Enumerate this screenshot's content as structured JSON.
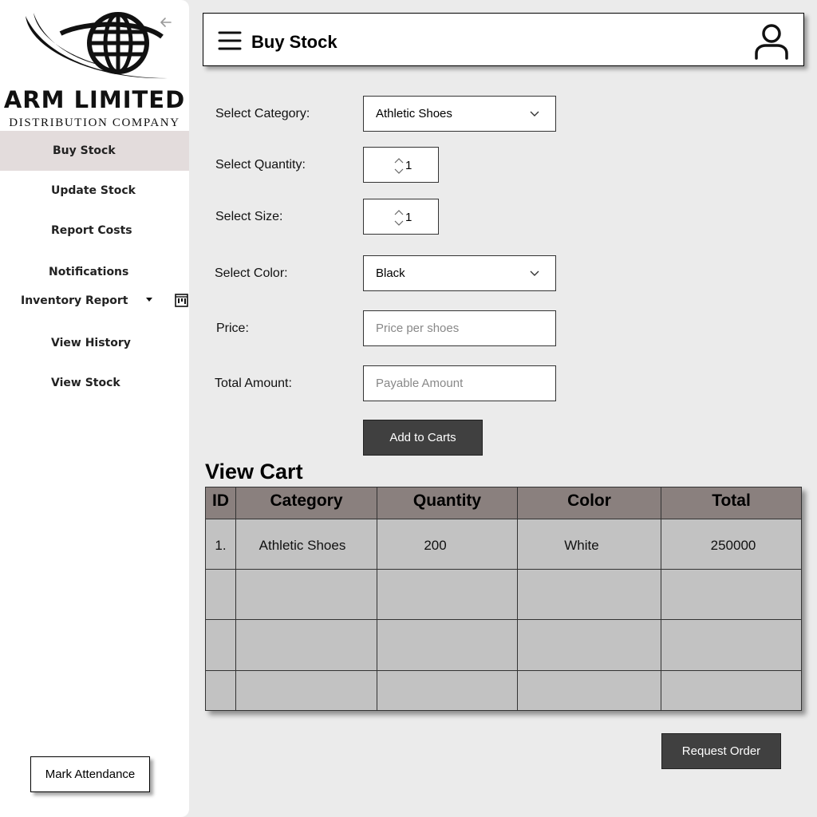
{
  "brand": {
    "name": "ARM LIMITED",
    "tagline": "DISTRIBUTION COMPANY"
  },
  "sidebar": {
    "items": [
      {
        "label": "Buy Stock",
        "active": true
      },
      {
        "label": "Update Stock"
      },
      {
        "label": "Report Costs"
      },
      {
        "label": "Notifications"
      },
      {
        "label": "Inventory Report",
        "has_dropdown": true
      },
      {
        "label": "View History"
      },
      {
        "label": "View Stock"
      }
    ],
    "attendance_label": "Mark Attendance"
  },
  "header": {
    "title": "Buy Stock",
    "icons": [
      "menu-icon",
      "user-icon"
    ]
  },
  "form": {
    "category": {
      "label": "Select Category:",
      "value": "Athletic Shoes"
    },
    "quantity": {
      "label": "Select Quantity:",
      "value": "1"
    },
    "size": {
      "label": "Select Size:",
      "value": "1"
    },
    "color": {
      "label": "Select Color:",
      "value": "Black"
    },
    "price": {
      "label": "Price:",
      "placeholder": "Price per shoes"
    },
    "total": {
      "label": "Total Amount:",
      "placeholder": "Payable Amount"
    },
    "add_label": "Add to Carts"
  },
  "cart": {
    "title": "View Cart",
    "columns": [
      "ID",
      "Category",
      "Quantity",
      "Color",
      "Total"
    ],
    "rows": [
      {
        "id": "1.",
        "category": "Athletic Shoes",
        "quantity": "200",
        "color": "White",
        "total": "250000"
      }
    ],
    "request_label": "Request Order"
  },
  "colors": {
    "active_nav": "#e3dcdc",
    "dark_button": "#404040",
    "table_header": "#8a807e",
    "table_body": "#c2c2c2"
  }
}
